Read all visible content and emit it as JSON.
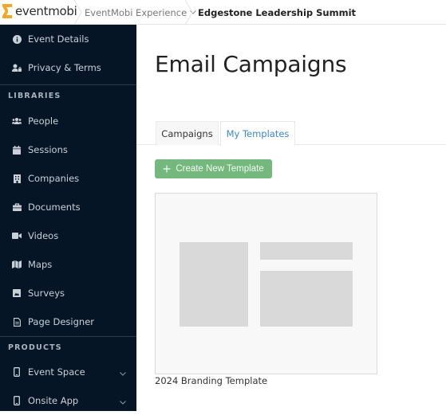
{
  "brand": {
    "name": "eventmobi",
    "accent": "#f5a623"
  },
  "breadcrumb": {
    "workspace": "EventMobi Experience",
    "event": "Edgestone Leadership Summit"
  },
  "sidebar": {
    "top_items": [
      {
        "label": "Event Details",
        "icon": "info-circle-icon"
      },
      {
        "label": "Privacy & Terms",
        "icon": "user-lock-icon"
      }
    ],
    "libraries_heading": "LIBRARIES",
    "libraries": [
      {
        "label": "People",
        "icon": "users-icon"
      },
      {
        "label": "Sessions",
        "icon": "calendar-icon"
      },
      {
        "label": "Companies",
        "icon": "building-icon"
      },
      {
        "label": "Documents",
        "icon": "briefcase-icon"
      },
      {
        "label": "Videos",
        "icon": "video-camera-icon"
      },
      {
        "label": "Maps",
        "icon": "map-icon"
      },
      {
        "label": "Surveys",
        "icon": "poll-icon"
      },
      {
        "label": "Page Designer",
        "icon": "file-icon"
      }
    ],
    "products_heading": "PRODUCTS",
    "products": [
      {
        "label": "Event Space",
        "icon": "mobile-icon"
      },
      {
        "label": "Onsite App",
        "icon": "mobile-icon"
      }
    ]
  },
  "main": {
    "title": "Email Campaigns",
    "tabs": [
      {
        "label": "Campaigns",
        "active": false
      },
      {
        "label": "My Templates",
        "active": true
      }
    ],
    "create_button": "Create New Template",
    "templates": [
      {
        "name": "2024 Branding Template"
      }
    ]
  },
  "colors": {
    "sidebar_bg": "#061526",
    "active_tab": "#3b86d4",
    "create_button": "#74b87d"
  }
}
